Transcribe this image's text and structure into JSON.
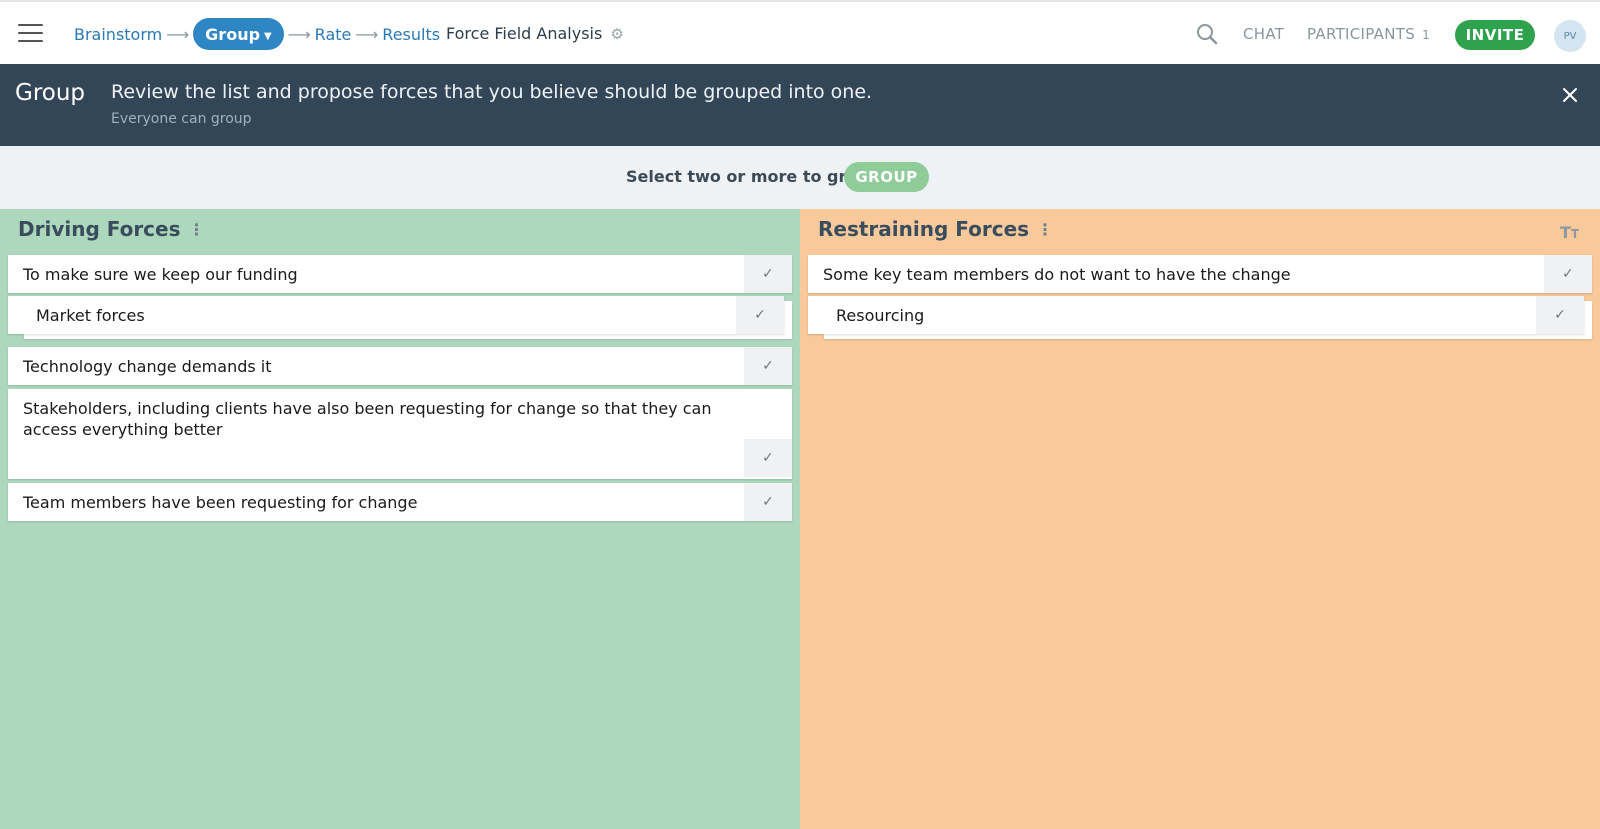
{
  "nav": {
    "steps": [
      {
        "label": "Brainstorm"
      },
      {
        "label": "Group"
      },
      {
        "label": "Rate"
      },
      {
        "label": "Results"
      }
    ],
    "session_title": "Force Field Analysis",
    "chat_label": "CHAT",
    "participants_label": "PARTICIPANTS",
    "participants_count": "1",
    "invite_label": "INVITE",
    "avatar_initials": "PV"
  },
  "banner": {
    "step_name": "Group",
    "message": "Review the list and propose forces that you believe should be grouped into one.",
    "sub": "Everyone can group"
  },
  "group_bar": {
    "hint": "Select two or more to group",
    "button_label": "GROUP"
  },
  "columns": [
    {
      "title": "Driving Forces",
      "cards": [
        {
          "text": "To make sure we keep our funding"
        },
        {
          "text": "Market forces"
        },
        {
          "text": "Technology change demands it"
        },
        {
          "text": "Stakeholders, including clients have also been requesting for change so that they can access everything better"
        },
        {
          "text": "Team members have been requesting for change"
        }
      ]
    },
    {
      "title": "Restraining Forces",
      "cards": [
        {
          "text": "Some key team members do not want to have the change"
        },
        {
          "text": "Resourcing"
        }
      ]
    }
  ],
  "colors": {
    "driving_bg": "#add8bd",
    "restraining_bg": "#f8c99b",
    "banner_bg": "#334657",
    "active_step": "#2e86c4",
    "invite": "#2fa24e"
  },
  "icons": {
    "menu": "hamburger-icon",
    "settings": "gear-icon",
    "search": "search-icon",
    "close": "close-icon",
    "check": "check-icon",
    "text_size": "text-size-icon"
  }
}
